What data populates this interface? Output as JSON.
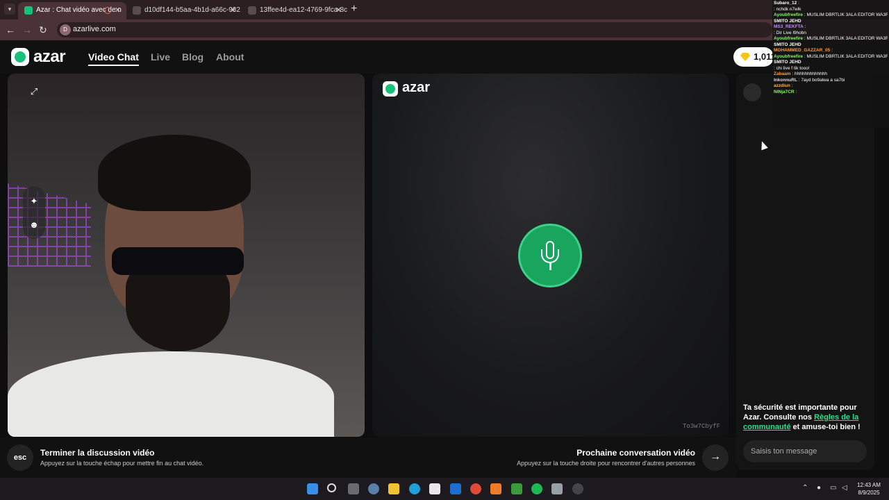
{
  "browser": {
    "tabs": [
      {
        "label": "Azar : Chat vidéo avec de n",
        "active": true,
        "fav_color": "#18c07a"
      },
      {
        "label": "d10df144-b5aa-4b1d-a66c-982",
        "active": false,
        "fav_color": "#5c4a4e"
      },
      {
        "label": "13ffee4d-ea12-4769-9fca-8c5d",
        "active": false,
        "fav_color": "#5c4a4e"
      }
    ],
    "new_tab": "+",
    "tab_close": "✕",
    "url": "azarlive.com",
    "back": "←",
    "forward": "→",
    "reload": "↻",
    "url_fav": "D"
  },
  "site": {
    "logo": "azar",
    "nav": {
      "video_chat": "Video Chat",
      "live": "Live",
      "blog": "Blog",
      "about": "About"
    },
    "gems": "1,011"
  },
  "left_panel": {
    "expand_icon": "⤢",
    "sparkle_icon": "✦",
    "face_icon": "☻"
  },
  "mid_panel": {
    "logo": "azar",
    "peer_id": "To3w7CbyfF"
  },
  "right_panel": {
    "safety_text_1": "Ta sécurité est importante pour Azar. Consulte nos ",
    "safety_link": "Règles de la communauté",
    "safety_text_2": " et amuse-toi bien !",
    "message_placeholder": "Saisis ton message"
  },
  "bottom": {
    "esc": "esc",
    "end_title": "Terminer la discussion vidéo",
    "end_sub": "Appuyez sur la touche échap pour mettre fin au chat vidéo.",
    "next_title": "Prochaine conversation vidéo",
    "next_sub": "Appuyez sur la touche droite pour rencontrer d'autres personnes",
    "next_arrow": "→"
  },
  "overlay_chat": [
    {
      "user": "Subaro_12",
      "msg": ":",
      "color": "#ffffff"
    },
    {
      "user": "",
      "msg": ": nchdk n7wlk",
      "color": "#ff6a6a"
    },
    {
      "user": "Ayoubfreefire",
      "msg": ": MUSLIM DBRTLIK 3ALA EDITOR WA3R",
      "color": "#7cff5a"
    },
    {
      "user": "SMITO JEHD",
      "msg": "",
      "color": "#ffffff"
    },
    {
      "user": "MS3_REKFTA",
      "msg": ":",
      "color": "#c08cff"
    },
    {
      "user": "",
      "msg": ": Dir Live l9hobn",
      "color": "#ff6a6a"
    },
    {
      "user": "Ayoubfreefire",
      "msg": ": MUSLIM DBRTLIK 3ALA EDITOR WA3R",
      "color": "#7cff5a"
    },
    {
      "user": "SMITO JEHD",
      "msg": "",
      "color": "#ffffff"
    },
    {
      "user": "MOHAMMED_GAZZAR_05",
      "msg": ":",
      "color": "#ff9a3c"
    },
    {
      "user": "Ayoubfreefire",
      "msg": ": MUSLIM DBRTLIK 3ALA EDITOR WA3R",
      "color": "#7cff5a"
    },
    {
      "user": "SMITO JEHD",
      "msg": "",
      "color": "#ffffff"
    },
    {
      "user": "",
      "msg": ": chi live f tik tooo!",
      "color": "#5ad6ff"
    },
    {
      "user": "Zabaam",
      "msg": ": hhhhhhhhhhhhh",
      "color": "#ff9a3c"
    },
    {
      "user": "InkonnuRL",
      "msg": ": 7ayd bo9alwa a sa7bi",
      "color": "#dddddd"
    },
    {
      "user": "azzdiun",
      "msg": ":",
      "color": "#ffb84a"
    },
    {
      "user": "NINja7CR",
      "msg": ":",
      "color": "#7cff5a"
    }
  ],
  "taskbar": {
    "time": "12:43 AM",
    "date": "8/9/2025",
    "tray_up": "⌃"
  }
}
